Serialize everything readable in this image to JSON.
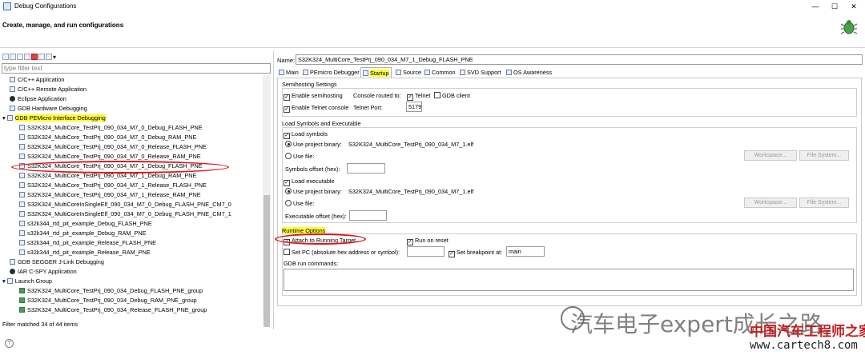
{
  "window": {
    "title": "Debug Configurations",
    "controls": [
      "—",
      "☐",
      "✕"
    ]
  },
  "header": {
    "title": "Create, manage, and run configurations"
  },
  "left": {
    "filter_placeholder": "type filter text",
    "filter_status": "Filter matched 34 of 44 items",
    "tree": [
      {
        "label": "C/C++ Application",
        "icon": "c-app-icon",
        "level": 1
      },
      {
        "label": "C/C++ Remote Application",
        "icon": "c-remote-icon",
        "level": 1
      },
      {
        "label": "Eclipse Application",
        "icon": "eclipse-icon",
        "level": 1
      },
      {
        "label": "GDB Hardware Debugging",
        "icon": "gdb-hw-icon",
        "level": 1
      },
      {
        "label": "GDB PEMicro Interface Debugging",
        "icon": "pemicro-icon",
        "level": 1,
        "expanded": true,
        "highlight": true
      },
      {
        "label": "S32K324_MultiCore_TestPrj_090_034_M7_0_Debug_FLASH_PNE",
        "icon": "config-icon",
        "level": 2
      },
      {
        "label": "S32K324_MultiCore_TestPrj_090_034_M7_0_Debug_RAM_PNE",
        "icon": "config-icon",
        "level": 2
      },
      {
        "label": "S32K324_MultiCore_TestPrj_090_034_M7_0_Release_FLASH_PNE",
        "icon": "config-icon",
        "level": 2
      },
      {
        "label": "S32K324_MultiCore_TestPrj_090_034_M7_0_Release_RAM_PNE",
        "icon": "config-icon",
        "level": 2
      },
      {
        "label": "S32K324_MultiCore_TestPrj_090_034_M7_1_Debug_FLASH_PNE",
        "icon": "config-icon",
        "level": 2,
        "selected": true
      },
      {
        "label": "S32K324_MultiCore_TestPrj_090_034_M7_1_Debug_RAM_PNE",
        "icon": "config-icon",
        "level": 2
      },
      {
        "label": "S32K324_MultiCore_TestPrj_090_034_M7_1_Release_FLASH_PNE",
        "icon": "config-icon",
        "level": 2
      },
      {
        "label": "S32K324_MultiCore_TestPrj_090_034_M7_1_Release_RAM_PNE",
        "icon": "config-icon",
        "level": 2
      },
      {
        "label": "S32K324_MultiCoreInSingleElf_090_034_M7_0_Debug_FLASH_PNE_CM7_0",
        "icon": "config-icon",
        "level": 2
      },
      {
        "label": "S32K324_MultiCoreInSingleElf_090_034_M7_0_Debug_FLASH_PNE_CM7_1",
        "icon": "config-icon",
        "level": 2
      },
      {
        "label": "s32k344_rtd_pit_example_Debug_FLASH_PNE",
        "icon": "config-icon",
        "level": 2
      },
      {
        "label": "s32k344_rtd_pit_example_Debug_RAM_PNE",
        "icon": "config-icon",
        "level": 2
      },
      {
        "label": "s32k344_rtd_pit_example_Release_FLASH_PNE",
        "icon": "config-icon",
        "level": 2
      },
      {
        "label": "s32k344_rtd_pit_example_Release_RAM_PNE",
        "icon": "config-icon",
        "level": 2
      },
      {
        "label": "GDB SEGGER J-Link Debugging",
        "icon": "segger-icon",
        "level": 1
      },
      {
        "label": "IAR C-SPY Application",
        "icon": "iar-icon",
        "level": 1
      },
      {
        "label": "Launch Group",
        "icon": "launch-group-icon",
        "level": 1,
        "expanded": true
      },
      {
        "label": "S32K324_MultiCore_TestPrj_090_034_Debug_FLASH_PNE_group",
        "icon": "group-icon",
        "level": 2
      },
      {
        "label": "S32K324_MultiCore_TestPrj_090_034_Debug_RAM_PNE_group",
        "icon": "group-icon",
        "level": 2
      },
      {
        "label": "S32K324_MultiCore_TestPrj_090_034_Release_FLASH_PNE_group",
        "icon": "group-icon",
        "level": 2
      }
    ]
  },
  "right": {
    "name_label": "Name:",
    "name_value": "S32K324_MultiCore_TestPrj_090_034_M7_1_Debug_FLASH_PNE",
    "tabs": [
      {
        "label": "Main",
        "icon": "main-tab-icon"
      },
      {
        "label": "PEmicro Debugger",
        "icon": "debugger-tab-icon"
      },
      {
        "label": "Startup",
        "icon": "startup-tab-icon",
        "selected": true
      },
      {
        "label": "Source",
        "icon": "source-tab-icon"
      },
      {
        "label": "Common",
        "icon": "common-tab-icon"
      },
      {
        "label": "SVD Support",
        "icon": "svd-tab-icon"
      },
      {
        "label": "OS Awareness",
        "icon": "os-tab-icon"
      }
    ],
    "semihosting": {
      "title": "Semihosting Settings",
      "enable_label": "Enable semihosting",
      "console_routed": "Console routed to:",
      "telnet_label": "Telnet",
      "gdb_client_label": "GDB client",
      "telnet_console_label": "Enable Telnet console",
      "telnet_port_label": "Telnet Port:",
      "telnet_port_value": "5179"
    },
    "load": {
      "title": "Load Symbols and Executable",
      "load_symbols": "Load symbols",
      "use_project_binary": "Use project binary:",
      "symbols_binary": "S32K324_MultiCore_TestPrj_090_034_M7_1.elf",
      "use_file": "Use file:",
      "workspace": "Workspace...",
      "file_system": "File System...",
      "symbols_offset": "Symbols offset (hex):",
      "load_executable": "Load executable",
      "exec_binary": "S32K324_MultiCore_TestPrj_090_034_M7_1.elf",
      "exec_offset": "Executable offset (hex):"
    },
    "runtime": {
      "title": "Runtime Options",
      "attach": "Attach to Running Target",
      "run_on_reset": "Run on reset",
      "set_pc": "Set PC (absolute hex address or symbol):",
      "set_breakpoint": "Set breakpoint at:",
      "breakpoint_value": "main",
      "gdb_cmds": "GDB run commands:"
    }
  },
  "watermark": {
    "line1": "汽车电子expert成长之路",
    "line2": "中国汽车工程师之家",
    "line3": "www.cartech8.com"
  }
}
